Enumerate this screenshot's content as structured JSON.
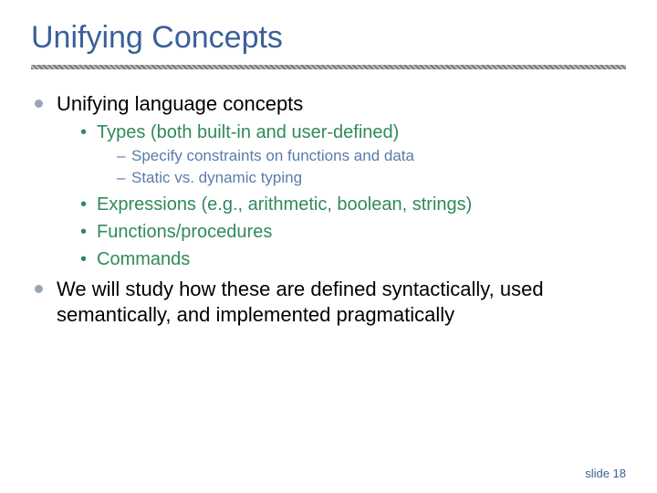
{
  "title": "Unifying Concepts",
  "bullets": {
    "b1": "Unifying language concepts",
    "b1_1": "Types (both built-in and user-defined)",
    "b1_1_1": "Specify constraints on functions and data",
    "b1_1_2": "Static vs. dynamic typing",
    "b1_2": "Expressions (e.g., arithmetic, boolean, strings)",
    "b1_3": "Functions/procedures",
    "b1_4": "Commands",
    "b2": "We will study how these are defined syntactically, used semantically, and implemented pragmatically"
  },
  "footer": "slide 18"
}
